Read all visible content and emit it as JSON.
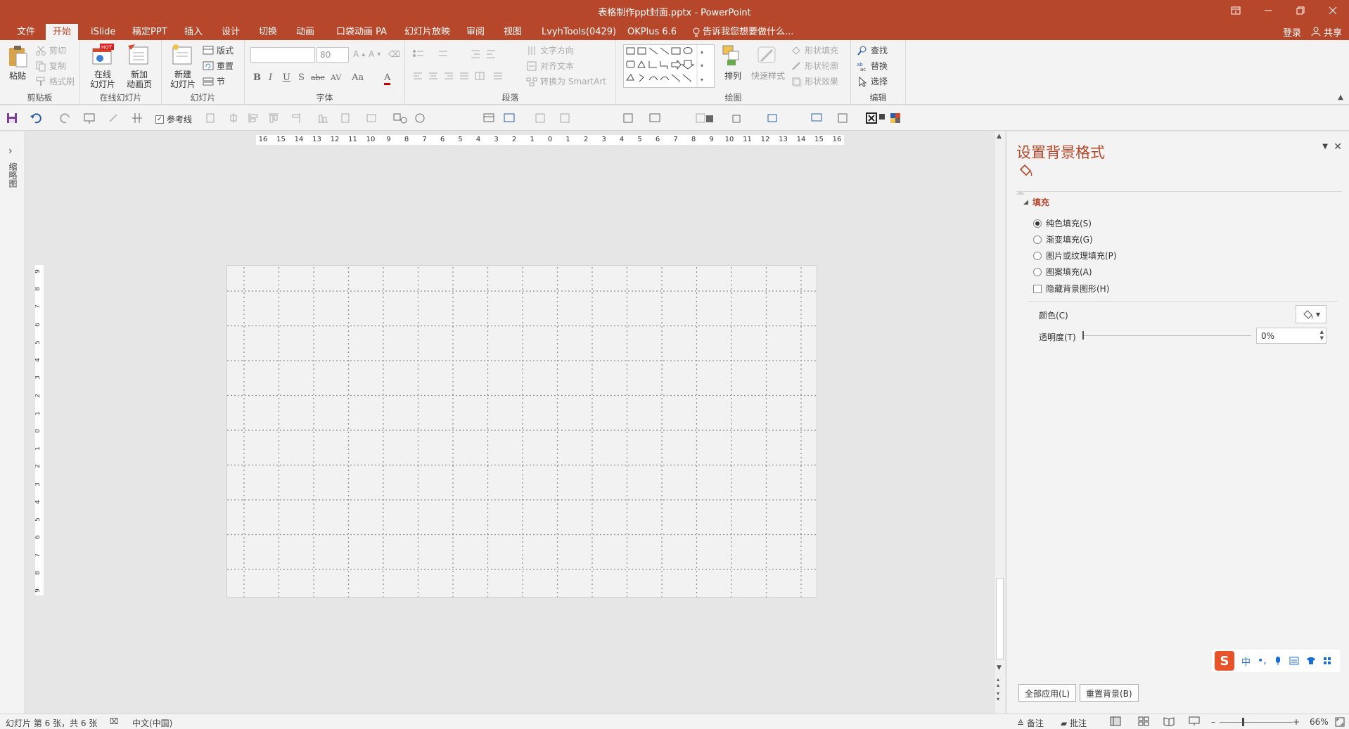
{
  "window": {
    "title": "表格制作ppt封面.pptx - PowerPoint",
    "controls": [
      "ribbon-display-options",
      "minimize",
      "restore",
      "close"
    ]
  },
  "tabs": [
    "文件",
    "开始",
    "iSlide",
    "稿定PPT",
    "插入",
    "设计",
    "切换",
    "动画",
    "口袋动画 PA",
    "幻灯片放映",
    "审阅",
    "视图",
    "LvyhTools(0429)",
    "OKPlus 6.6"
  ],
  "active_tab": "开始",
  "tell_me": "告诉我您想要做什么...",
  "account": {
    "login": "登录",
    "share": "共享"
  },
  "ribbon": {
    "clipboard": {
      "paste": "粘贴",
      "cut": "剪切",
      "copy": "复制",
      "format_painter": "格式刷",
      "label": "剪贴板"
    },
    "online_slides": {
      "online": "在线\n幻灯片",
      "new_anim": "新加\n动画页",
      "label": "在线幻灯片",
      "hot_badge": "HOT"
    },
    "slides": {
      "new_slide": "新建\n幻灯片",
      "layout": "版式",
      "reset": "重置",
      "section": "节",
      "label": "幻灯片"
    },
    "font": {
      "font_size": "80",
      "label": "字体",
      "bold": "B",
      "italic": "I",
      "underline": "U",
      "shadow": "S",
      "strike": "abc",
      "spacing": "AV",
      "case": "Aa",
      "color": "A"
    },
    "paragraph": {
      "text_direction": "文字方向",
      "align_text": "对齐文本",
      "smartart": "转换为 SmartArt",
      "label": "段落"
    },
    "drawing": {
      "arrange": "排列",
      "quick_styles": "快速样式",
      "shape_fill": "形状填充",
      "shape_outline": "形状轮廓",
      "shape_effects": "形状效果",
      "label": "绘图"
    },
    "editing": {
      "find": "查找",
      "replace": "替换",
      "select": "选择",
      "label": "编辑"
    }
  },
  "qat": {
    "guides_label": "参考线",
    "guides_checked": true
  },
  "left_panel": {
    "collapsed_label": "缩略图"
  },
  "rulers": {
    "horizontal": [
      "16",
      "15",
      "14",
      "13",
      "12",
      "11",
      "10",
      "9",
      "8",
      "7",
      "6",
      "5",
      "4",
      "3",
      "2",
      "1",
      "0",
      "1",
      "2",
      "3",
      "4",
      "5",
      "6",
      "7",
      "8",
      "9",
      "10",
      "11",
      "12",
      "13",
      "14",
      "15",
      "16"
    ],
    "vertical": [
      "9",
      "8",
      "7",
      "6",
      "5",
      "4",
      "3",
      "2",
      "1",
      "0",
      "1",
      "2",
      "3",
      "4",
      "5",
      "6",
      "7",
      "8",
      "9"
    ]
  },
  "format_pane": {
    "title": "设置背景格式",
    "section": "填充",
    "options": [
      {
        "label": "纯色填充(S)",
        "selected": true
      },
      {
        "label": "渐变填充(G)",
        "selected": false
      },
      {
        "label": "图片或纹理填充(P)",
        "selected": false
      },
      {
        "label": "图案填充(A)",
        "selected": false
      }
    ],
    "hide_bg": "隐藏背景图形(H)",
    "color_label": "颜色(C)",
    "transparency_label": "透明度(T)",
    "transparency_value": "0%",
    "apply_all": "全部应用(L)",
    "reset_bg": "重置背景(B)"
  },
  "ime": {
    "mode": "中"
  },
  "statusbar": {
    "slide_info": "幻灯片 第 6 张，共 6 张",
    "language": "中文(中国)",
    "notes": "备注",
    "comments": "批注",
    "zoom": "66%"
  },
  "colors": {
    "accent": "#b7472a",
    "ribbon_bg": "#f3f3f3",
    "canvas_bg": "#e6e6e6",
    "slide_bg": "#f2f2f2"
  }
}
